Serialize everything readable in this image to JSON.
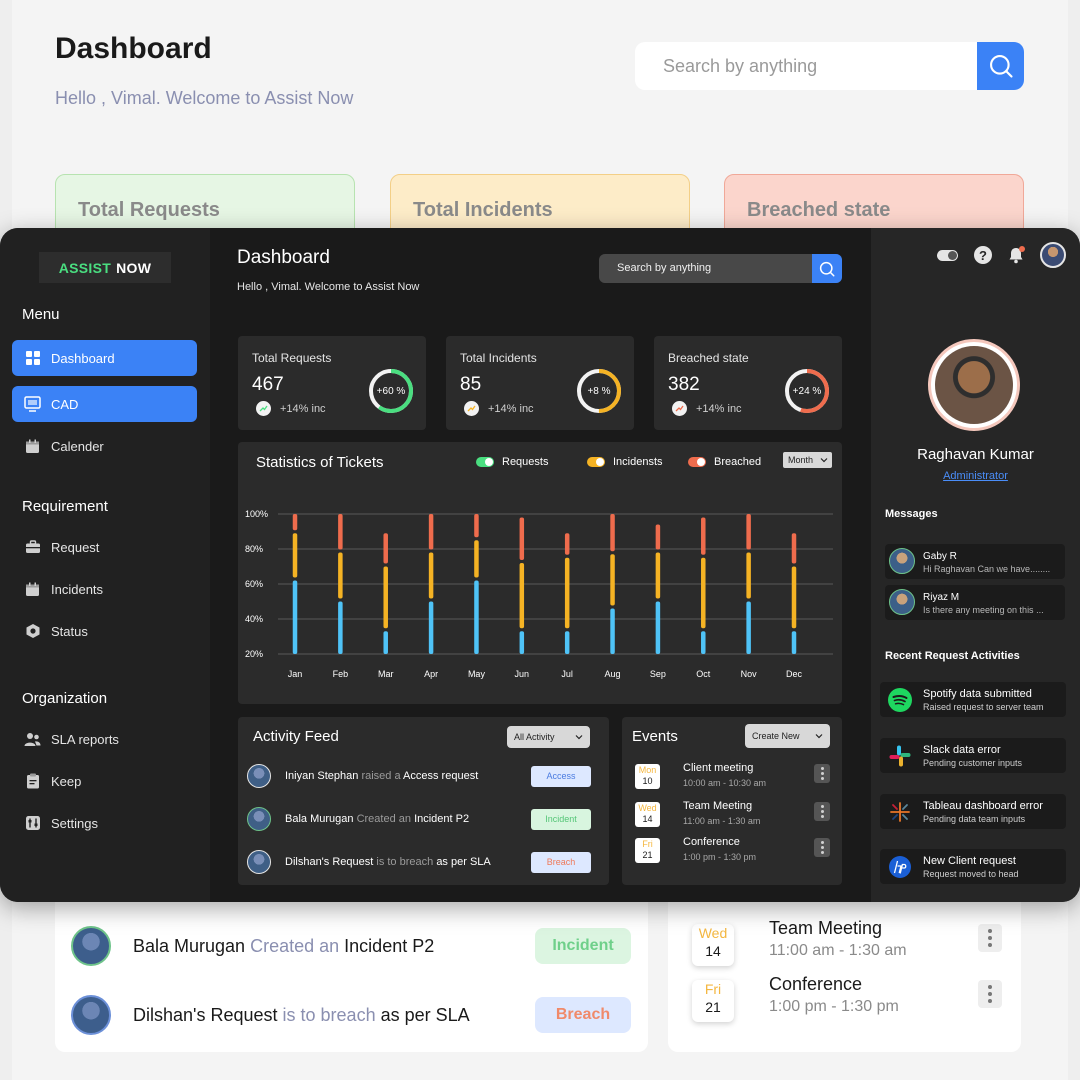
{
  "background": {
    "title": "Dashboard",
    "subtitle": "Hello , Vimal. Welcome to Assist Now",
    "search_placeholder": "Search by anything",
    "cards": [
      "Total Requests",
      "Total Incidents",
      "Breached state"
    ],
    "feed": [
      {
        "name": "Bala Murugan",
        "action": "Created an",
        "object": "Incident P2",
        "badge": "Incident"
      },
      {
        "name": "Dilshan's Request",
        "action": "is to breach",
        "object": "as per SLA",
        "badge": "Breach"
      }
    ],
    "events": [
      {
        "day": "Wed",
        "date": "14",
        "title": "Team Meeting",
        "time": "11:00 am - 1:30 am"
      },
      {
        "day": "Fri",
        "date": "21",
        "title": "Conference",
        "time": "1:00 pm - 1:30 pm"
      }
    ]
  },
  "app": {
    "logo": {
      "part1": "ASSIST",
      "part2": "NOW"
    },
    "menu_heading": "Menu",
    "nav": [
      {
        "label": "Dashboard",
        "icon": "grid-icon",
        "active": true
      },
      {
        "label": "CAD",
        "icon": "monitor-icon",
        "active": true
      },
      {
        "label": "Calender",
        "icon": "calendar-icon",
        "active": false
      }
    ],
    "requirement_heading": "Requirement",
    "requirement_nav": [
      {
        "label": "Request",
        "icon": "briefcase-icon"
      },
      {
        "label": "Incidents",
        "icon": "calendar-icon"
      },
      {
        "label": "Status",
        "icon": "hexagon-icon"
      }
    ],
    "organization_heading": "Organization",
    "organization_nav": [
      {
        "label": "SLA reports",
        "icon": "users-icon"
      },
      {
        "label": "Keep",
        "icon": "clipboard-icon"
      },
      {
        "label": "Settings",
        "icon": "sliders-icon"
      }
    ],
    "header": {
      "title": "Dashboard",
      "subtitle": "Hello , Vimal. Welcome to Assist Now",
      "search_placeholder": "Search by anything"
    },
    "kpis": [
      {
        "label": "Total Requests",
        "value": "467",
        "inc": "+14% inc",
        "ring_label": "+60 %",
        "ring_fraction": 0.6,
        "color": "#4ade80"
      },
      {
        "label": "Total Incidents",
        "value": "85",
        "inc": "+14% inc",
        "ring_label": "+8 %",
        "ring_fraction": 0.5,
        "color": "#f5b324"
      },
      {
        "label": "Breached state",
        "value": "382",
        "inc": "+14% inc",
        "ring_label": "+24 %",
        "ring_fraction": 0.55,
        "color": "#ef6c4d"
      }
    ],
    "stats": {
      "title": "Statistics of Tickets",
      "period": "Month"
    },
    "activity": {
      "title": "Activity Feed",
      "filter": "All Activity",
      "rows": [
        {
          "name": "Iniyan Stephan",
          "action": "raised a",
          "object": "Access request",
          "badge": "Access",
          "badge_type": "access"
        },
        {
          "name": "Bala Murugan",
          "action": "Created an",
          "object": "Incident P2",
          "badge": "Incident",
          "badge_type": "incident"
        },
        {
          "name": "Dilshan's Request",
          "action": "is to breach",
          "object": "as per SLA",
          "badge": "Breach",
          "badge_type": "breach"
        }
      ]
    },
    "events": {
      "title": "Events",
      "create_label": "Create New",
      "rows": [
        {
          "day": "Mon",
          "date": "10",
          "title": "Client meeting",
          "time": "10:00 am - 10:30 am"
        },
        {
          "day": "Wed",
          "date": "14",
          "title": "Team Meeting",
          "time": "11:00 am - 1:30 am"
        },
        {
          "day": "Fri",
          "date": "21",
          "title": "Conference",
          "time": "1:00 pm - 1:30 pm"
        }
      ]
    },
    "profile": {
      "name": "Raghavan Kumar",
      "role": "Administrator"
    },
    "messages": {
      "heading": "Messages",
      "items": [
        {
          "name": "Gaby R",
          "text": "Hi Raghavan Can we have........"
        },
        {
          "name": "Riyaz M",
          "text": "Is there any meeting on this ..."
        }
      ]
    },
    "recent": {
      "heading": "Recent Request Activities",
      "items": [
        {
          "title": "Spotify data submitted",
          "sub": "Raised request to server team",
          "icon": "spotify-icon"
        },
        {
          "title": "Slack data error",
          "sub": "Pending customer inputs",
          "icon": "slack-icon"
        },
        {
          "title": "Tableau dashboard error",
          "sub": "Pending data team inputs",
          "icon": "tableau-icon"
        },
        {
          "title": "New Client request",
          "sub": "Request moved to head",
          "icon": "hp-icon"
        }
      ]
    }
  },
  "chart_data": {
    "type": "bar",
    "title": "Statistics of Tickets",
    "categories": [
      "Jan",
      "Feb",
      "Mar",
      "Apr",
      "May",
      "Jun",
      "Jul",
      "Aug",
      "Sep",
      "Oct",
      "Nov",
      "Dec"
    ],
    "yticks": [
      "100%",
      "80%",
      "60%",
      "40%",
      "20%"
    ],
    "ylim": [
      20,
      100
    ],
    "stacked": true,
    "series": [
      {
        "name": "Requests",
        "color": "#4fc3f7",
        "values": [
          62,
          50,
          33,
          50,
          62,
          33,
          33,
          46,
          50,
          33,
          50,
          33
        ]
      },
      {
        "name": "Incidensts",
        "color": "#f5b324",
        "values": [
          89,
          78,
          70,
          78,
          85,
          72,
          75,
          77,
          78,
          75,
          78,
          70
        ]
      },
      {
        "name": "Breached",
        "color": "#ef6c4d",
        "values": [
          100,
          100,
          89,
          100,
          100,
          98,
          89,
          100,
          94,
          98,
          100,
          89
        ]
      }
    ],
    "legend": "top-right",
    "grid": true
  }
}
